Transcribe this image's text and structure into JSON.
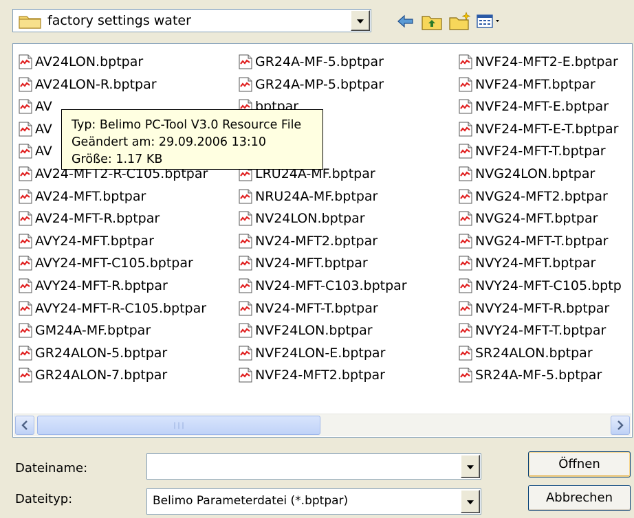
{
  "toolbar": {
    "folder_name": "factory settings water",
    "icons": [
      "back-arrow-icon",
      "folder-up-icon",
      "new-folder-icon",
      "view-menu-icon"
    ]
  },
  "files": {
    "col1": [
      "AV24LON.bptpar",
      "AV24LON-R.bptpar",
      "AV",
      "AV",
      "AV",
      "AV24-MFT2-R-C105.bptpar",
      "AV24-MFT.bptpar",
      "AV24-MFT-R.bptpar",
      "AVY24-MFT.bptpar",
      "AVY24-MFT-C105.bptpar",
      "AVY24-MFT-R.bptpar",
      "AVY24-MFT-R-C105.bptpar",
      "GM24A-MF.bptpar",
      "GR24ALON-5.bptpar",
      "GR24ALON-7.bptpar"
    ],
    "col2": [
      "GR24A-MF-5.bptpar",
      "GR24A-MP-5.bptpar",
      "bptpar",
      "bptpar",
      "bptpar",
      "LRU24A-MF.bptpar",
      "NRU24A-MF.bptpar",
      "NV24LON.bptpar",
      "NV24-MFT2.bptpar",
      "NV24-MFT.bptpar",
      "NV24-MFT-C103.bptpar",
      "NV24-MFT-T.bptpar",
      "NVF24LON.bptpar",
      "NVF24LON-E.bptpar",
      "NVF24-MFT2.bptpar"
    ],
    "col3": [
      "NVF24-MFT2-E.bptpar",
      "NVF24-MFT.bptpar",
      "NVF24-MFT-E.bptpar",
      "NVF24-MFT-E-T.bptpar",
      "NVF24-MFT-T.bptpar",
      "NVG24LON.bptpar",
      "NVG24-MFT2.bptpar",
      "NVG24-MFT.bptpar",
      "NVG24-MFT-T.bptpar",
      "NVY24-MFT.bptpar",
      "NVY24-MFT-C105.bptp",
      "NVY24-MFT-R.bptpar",
      "NVY24-MFT-T.bptpar",
      "SR24ALON.bptpar",
      "SR24A-MF-5.bptpar"
    ]
  },
  "tooltip": {
    "type_line": "Typ: Belimo PC-Tool V3.0 Resource File",
    "modified_line": "Geändert am: 29.09.2006 13:10",
    "size_line": "Größe: 1.17 KB"
  },
  "form": {
    "filename_label": "Dateiname:",
    "filename_value": "",
    "filetype_label": "Dateityp:",
    "filetype_value": "Belimo Parameterdatei (*.bptpar)",
    "open_button": "Öffnen",
    "cancel_button": "Abbrechen"
  },
  "colors": {
    "accent": "#003c74",
    "window_bg": "#ece9d8",
    "tooltip_bg": "#ffffe1",
    "file_icon_red": "#e02020"
  }
}
